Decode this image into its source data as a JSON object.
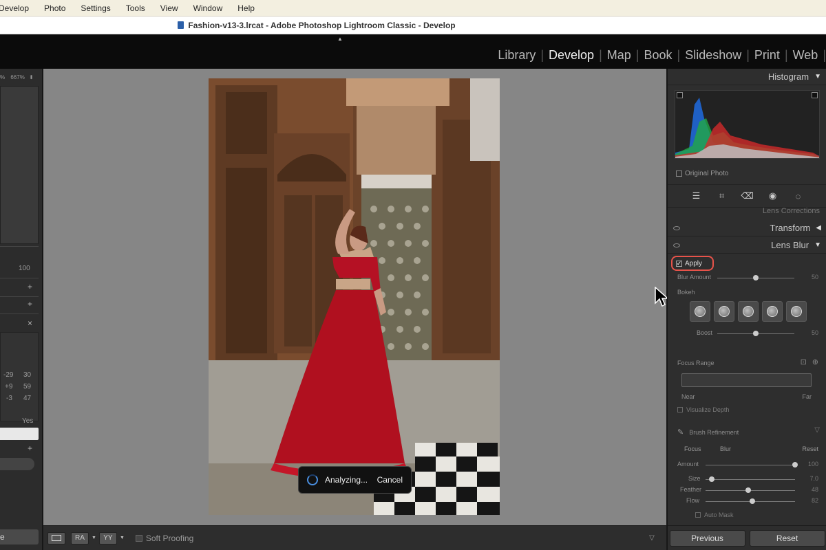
{
  "menubar": {
    "items": [
      "Develop",
      "Photo",
      "Settings",
      "Tools",
      "View",
      "Window",
      "Help"
    ]
  },
  "window": {
    "title": "Fashion-v13-3.lrcat - Adobe Photoshop Lightroom Classic - Develop"
  },
  "modules": {
    "items": [
      "Library",
      "Develop",
      "Map",
      "Book",
      "Slideshow",
      "Print",
      "Web"
    ],
    "active": "Develop"
  },
  "left_panel": {
    "zoom_a": "%",
    "zoom_b": "667%",
    "zoom_arrow": "⬍",
    "value_100": "100",
    "rows": [
      {
        "a": "-29",
        "b": "30"
      },
      {
        "a": "+9",
        "b": "59"
      },
      {
        "a": "-3",
        "b": "47"
      }
    ],
    "yes": "Yes",
    "close": "×",
    "bottom_button": "e"
  },
  "photo": {
    "subject": "Woman in red lehenga leaning on mosaic column in carved wooden courtyard"
  },
  "analyzing_toast": {
    "text": "Analyzing...",
    "cancel": "Cancel"
  },
  "toolbar": {
    "view_a": "",
    "view_b": "RA",
    "view_c": "YY",
    "soft_proofing": "Soft Proofing"
  },
  "right_panel": {
    "histogram": "Histogram",
    "original_photo": "Original Photo",
    "lens_corrections": "Lens Corrections",
    "transform": "Transform",
    "lens_blur": "Lens Blur",
    "apply": "Apply",
    "blur_amount": {
      "label": "Blur Amount",
      "value": "50",
      "fraction": 0.5
    },
    "bokeh_label": "Bokeh",
    "boost": {
      "label": "Boost",
      "value": "50",
      "fraction": 0.5
    },
    "focus_range": "Focus Range",
    "near": "Near",
    "far": "Far",
    "visualize_depth": "Visualize Depth",
    "brush_refinement": "Brush Refinement",
    "focus_tab": "Focus",
    "blur_tab": "Blur",
    "reset_small": "Reset",
    "brush_sliders": [
      {
        "label": "Amount",
        "value": "100",
        "fraction": 1.0
      },
      {
        "label": "Size",
        "value": "7.0",
        "fraction": 0.07
      },
      {
        "label": "Feather",
        "value": "48",
        "fraction": 0.48
      },
      {
        "label": "Flow",
        "value": "82",
        "fraction": 0.52
      }
    ],
    "auto_mask": "Auto Mask",
    "previous": "Previous",
    "reset": "Reset"
  },
  "colors": {
    "accent_highlight": "#e8534a",
    "spinner": "#4a8fe0"
  }
}
